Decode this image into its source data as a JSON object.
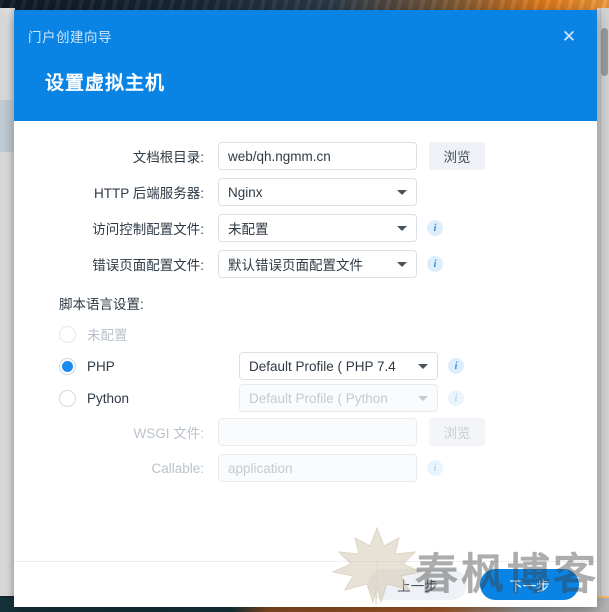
{
  "dialog": {
    "title": "门户创建向导",
    "heading": "设置虚拟主机",
    "close_label": "✕"
  },
  "form": {
    "rows": [
      {
        "label": "文档根目录:",
        "type": "text",
        "value": "web/qh.ngmm.cn",
        "button": "浏览",
        "info": false,
        "disabled": false
      },
      {
        "label": "HTTP 后端服务器:",
        "type": "select",
        "value": "Nginx",
        "info": false,
        "disabled": false
      },
      {
        "label": "访问控制配置文件:",
        "type": "select",
        "value": "未配置",
        "info": true,
        "disabled": false
      },
      {
        "label": "错误页面配置文件:",
        "type": "select",
        "value": "默认错误页面配置文件",
        "info": true,
        "disabled": false
      }
    ]
  },
  "script_section": {
    "label": "脚本语言设置:",
    "options": [
      {
        "label": "未配置",
        "checked": false,
        "disabled": true,
        "control": null
      },
      {
        "label": "PHP",
        "checked": true,
        "disabled": false,
        "control": {
          "type": "select",
          "value": "Default Profile ( PHP 7.4",
          "disabled": false,
          "info": true
        }
      },
      {
        "label": "Python",
        "checked": false,
        "disabled": false,
        "control": {
          "type": "select",
          "value": "Default Profile ( Python",
          "disabled": true,
          "info": true
        }
      }
    ],
    "wsgi_rows": [
      {
        "label": "WSGI 文件:",
        "type": "text",
        "value": "",
        "placeholder": "",
        "button": "浏览",
        "info": false,
        "disabled": true
      },
      {
        "label": "Callable:",
        "type": "text",
        "value": "",
        "placeholder": "application",
        "button": null,
        "info": true,
        "disabled": true
      }
    ]
  },
  "footer": {
    "prev_label": "上一步",
    "next_label": "下一步"
  },
  "watermark": {
    "text": "春枫博客"
  },
  "colors": {
    "accent": "#0a84e4",
    "radio_selected": "#1a8cf0",
    "info_bg": "#dceefc",
    "info_fg": "#2b8de0",
    "button_secondary": "#eef1f5"
  }
}
